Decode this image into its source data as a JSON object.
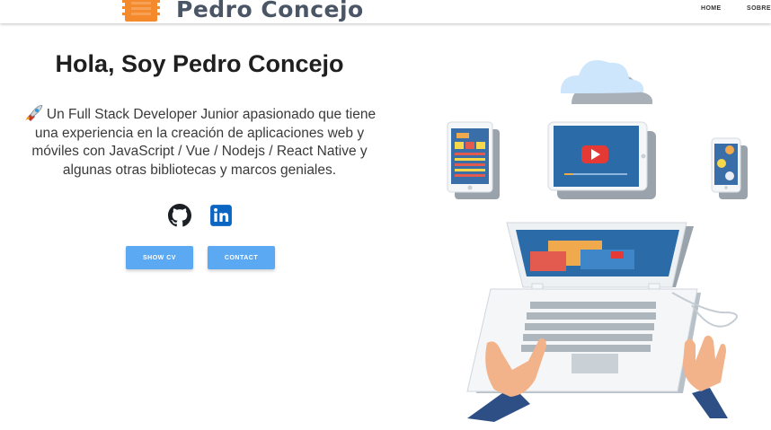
{
  "navbar": {
    "brand_name": "Pedro Concejo",
    "links": [
      {
        "label": "HOME"
      },
      {
        "label": "SOBRE"
      }
    ]
  },
  "hero": {
    "title": "Hola, Soy Pedro Concejo",
    "description": "Un Full Stack Developer Junior apasionado que tiene una experiencia en la creación de aplicaciones web y móviles con JavaScript / Vue / Nodejs / React Native y algunas otras bibliotecas y marcos geniales."
  },
  "social": [
    {
      "icon": "github-icon"
    },
    {
      "icon": "linkedin-icon"
    }
  ],
  "buttons": {
    "cv_label": "SHOW CV",
    "contact_label": "CONTACT"
  },
  "colors": {
    "accent": "#5ba9f2",
    "linkedin": "#0a66c2",
    "brand_text": "#4a5565",
    "logo_orange": "#f58a2c"
  }
}
